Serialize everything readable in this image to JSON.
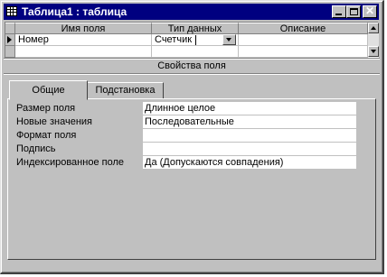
{
  "window": {
    "title": "Таблица1 : таблица"
  },
  "grid": {
    "headers": [
      "Имя поля",
      "Тип данных",
      "Описание"
    ],
    "rows": [
      {
        "name": "Номер",
        "type": "Счетчик",
        "description": ""
      }
    ]
  },
  "properties_title": "Свойства поля",
  "tabs": [
    "Общие",
    "Подстановка"
  ],
  "active_tab": "Общие",
  "properties": [
    {
      "label": "Размер поля",
      "value": "Длинное целое"
    },
    {
      "label": "Новые значения",
      "value": "Последовательные"
    },
    {
      "label": "Формат поля",
      "value": ""
    },
    {
      "label": "Подпись",
      "value": ""
    },
    {
      "label": "Индексированное поле",
      "value": "Да (Допускаются совпадения)"
    }
  ],
  "icons": {
    "window": "table-icon",
    "minimize": "minimize-icon",
    "maximize": "maximize-icon",
    "close": "close-icon",
    "current_row": "row-pointer-icon",
    "dropdown": "chevron-down-icon"
  },
  "colors": {
    "titlebar": "#000080",
    "face": "#c0c0c0"
  }
}
